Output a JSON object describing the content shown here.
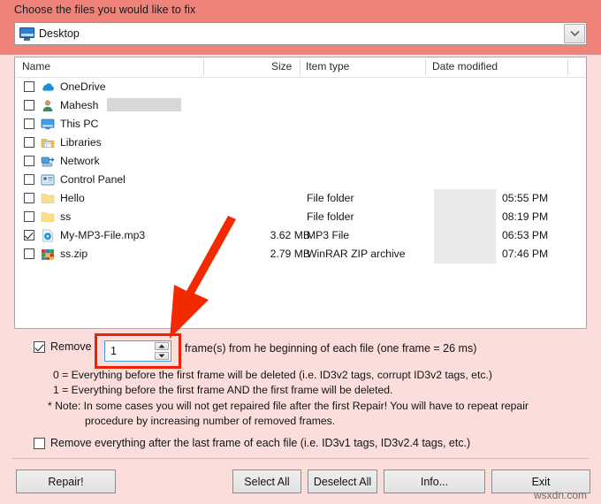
{
  "header": {
    "prompt": "Choose the files you would like to fix"
  },
  "location": {
    "icon": "desktop-icon",
    "value": "Desktop",
    "dropdown_icon": "chevron-down-icon"
  },
  "file_list": {
    "columns": [
      "Name",
      "Size",
      "Item type",
      "Date modified"
    ],
    "rows": [
      {
        "checked": false,
        "icon": "onedrive-cloud-icon",
        "name": "OneDrive",
        "size": "",
        "type": "",
        "time": "",
        "redacted": false,
        "date_blurred": false
      },
      {
        "checked": false,
        "icon": "user-account-icon",
        "name": "Mahesh",
        "size": "",
        "type": "",
        "time": "",
        "redacted": true,
        "date_blurred": false
      },
      {
        "checked": false,
        "icon": "this-pc-monitor-icon",
        "name": "This PC",
        "size": "",
        "type": "",
        "time": "",
        "redacted": false,
        "date_blurred": false
      },
      {
        "checked": false,
        "icon": "libraries-icon",
        "name": "Libraries",
        "size": "",
        "type": "",
        "time": "",
        "redacted": false,
        "date_blurred": false
      },
      {
        "checked": false,
        "icon": "network-icon",
        "name": "Network",
        "size": "",
        "type": "",
        "time": "",
        "redacted": false,
        "date_blurred": false
      },
      {
        "checked": false,
        "icon": "control-panel-icon",
        "name": "Control Panel",
        "size": "",
        "type": "",
        "time": "",
        "redacted": false,
        "date_blurred": false
      },
      {
        "checked": false,
        "icon": "folder-icon",
        "name": "Hello",
        "size": "",
        "type": "File folder",
        "time": "05:55 PM",
        "redacted": false,
        "date_blurred": true
      },
      {
        "checked": false,
        "icon": "folder-icon",
        "name": "ss",
        "size": "",
        "type": "File folder",
        "time": "08:19 PM",
        "redacted": false,
        "date_blurred": true
      },
      {
        "checked": true,
        "icon": "mp3-file-icon",
        "name": "My-MP3-File.mp3",
        "size": "3.62 MB",
        "type": "MP3 File",
        "time": "06:53 PM",
        "redacted": false,
        "date_blurred": true
      },
      {
        "checked": false,
        "icon": "winrar-zip-icon",
        "name": "ss.zip",
        "size": "2.79 MB",
        "type": "WinRAR ZIP archive",
        "time": "07:46 PM",
        "redacted": false,
        "date_blurred": true
      }
    ]
  },
  "options": {
    "remove_frames_checked": true,
    "remove_frames_label": "Remove",
    "frame_count": "1",
    "frames_tail_label": "frame(s) from he beginning of each file (one frame = 26 ms)",
    "spinner_up_icon": "spinner-up-arrow-icon",
    "spinner_down_icon": "spinner-down-arrow-icon",
    "hint_zero": "0 = Everything before the first frame will be deleted (i.e. ID3v2 tags, corrupt ID3v2 tags, etc.)",
    "hint_one": "1 = Everything before the first frame AND the first frame will be deleted.",
    "note_line1": "* Note: In some cases you will not get repaired file after the first Repair! You will have to repeat repair",
    "note_line2": "procedure by increasing number of removed frames.",
    "remove_after_last_checked": false,
    "remove_after_last_label": "Remove everything after the last frame of each file (i.e. ID3v1 tags, ID3v2.4 tags, etc.)"
  },
  "buttons": {
    "repair": "Repair!",
    "select_all": "Select All",
    "deselect_all": "Deselect All",
    "info": "Info...",
    "exit": "Exit"
  },
  "annotation": {
    "arrow_color": "#f02000",
    "highlight_color": "#f02000",
    "arrow_icon": "red-pointer-arrow-icon"
  },
  "watermark": "wsxdn.com",
  "colors": {
    "band": "#ef8279",
    "panel": "#fbdedc",
    "accent_red": "#f02000"
  }
}
